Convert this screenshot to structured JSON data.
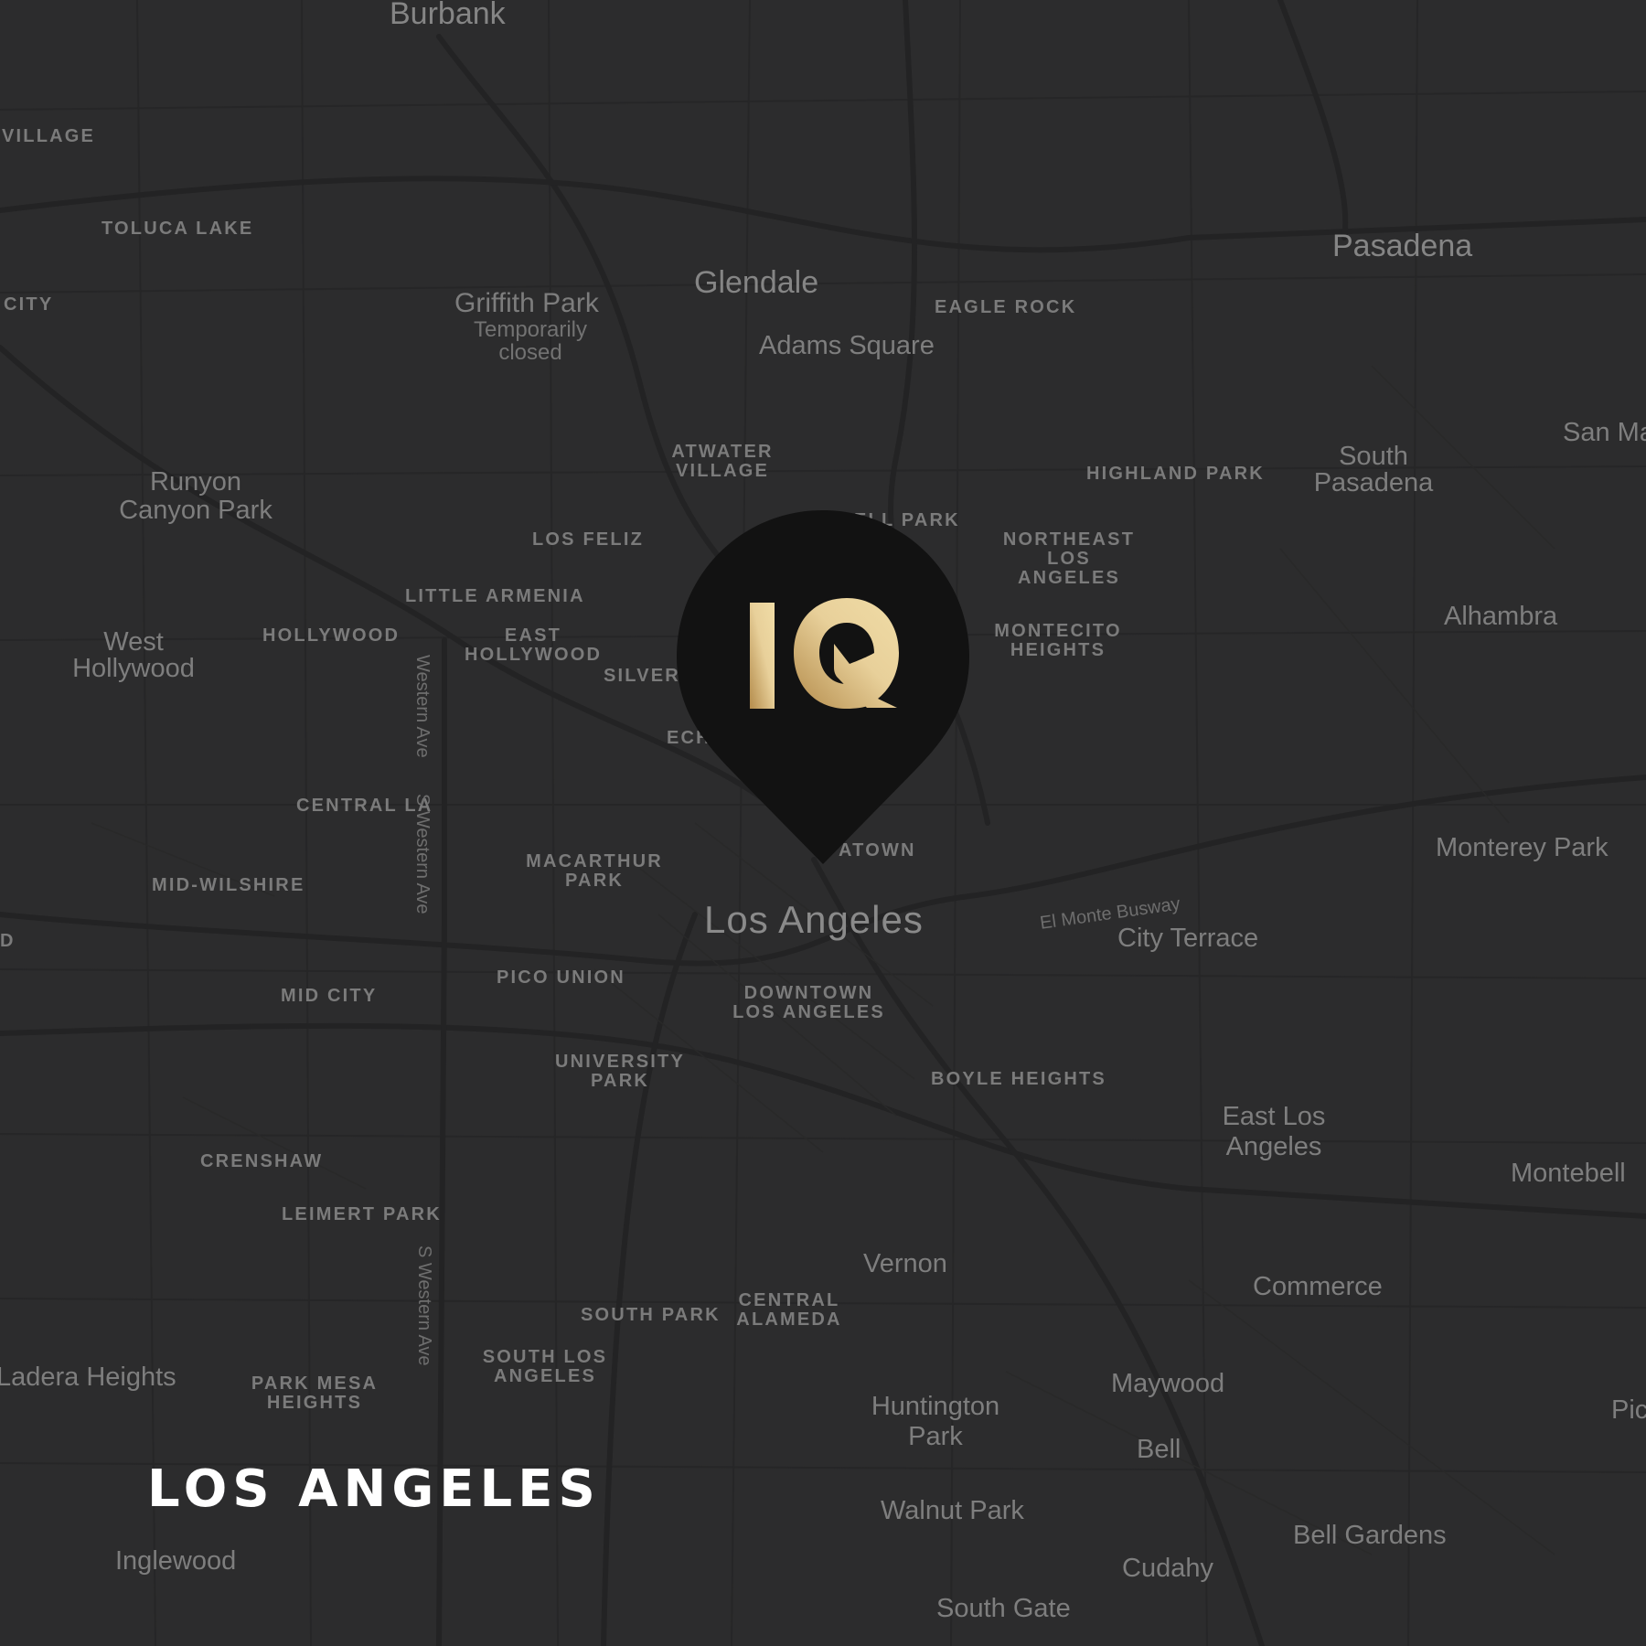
{
  "map": {
    "title": "LOS ANGELES",
    "marker": {
      "brand": "IQ",
      "icon": "map-pin-icon"
    },
    "colors": {
      "background": "#2c2c2d",
      "roads": "#222223",
      "pin": "#121212",
      "gold_light": "#f0dca6",
      "gold_dark": "#b48c4c"
    },
    "places": [
      {
        "name": "Burbank"
      },
      {
        "name": "Glendale"
      },
      {
        "name": "Pasadena"
      },
      {
        "name": "Adams Square"
      },
      {
        "name": "Runyon Canyon Park"
      },
      {
        "name": "West Hollywood"
      },
      {
        "name": "South Pasadena"
      },
      {
        "name": "San Ma"
      },
      {
        "name": "Alhambra"
      },
      {
        "name": "Monterey Park"
      },
      {
        "name": "Los Angeles"
      },
      {
        "name": "City Terrace"
      },
      {
        "name": "East Los Angeles"
      },
      {
        "name": "Montebell"
      },
      {
        "name": "Vernon"
      },
      {
        "name": "Commerce"
      },
      {
        "name": "Huntington Park"
      },
      {
        "name": "Maywood"
      },
      {
        "name": "Bell"
      },
      {
        "name": "Ladera Heights"
      },
      {
        "name": "Walnut Park"
      },
      {
        "name": "Bell Gardens"
      },
      {
        "name": "Inglewood"
      },
      {
        "name": "Cudahy"
      },
      {
        "name": "South Gate"
      },
      {
        "name": "Pic"
      }
    ],
    "park": {
      "name": "Griffith Park",
      "status": "Temporarily closed"
    },
    "neighborhoods": [
      {
        "name": "VILLAGE"
      },
      {
        "name": "TOLUCA LAKE"
      },
      {
        "name": "CITY"
      },
      {
        "name": "EAGLE ROCK"
      },
      {
        "name": "ATWATER VILLAGE"
      },
      {
        "name": "HIGHLAND PARK"
      },
      {
        "name": "LOS FELIZ"
      },
      {
        "name": "ELL PARK"
      },
      {
        "name": "NORTHEAST LOS ANGELES"
      },
      {
        "name": "LITTLE ARMENIA"
      },
      {
        "name": "HOLLYWOOD"
      },
      {
        "name": "EAST HOLLYWOOD"
      },
      {
        "name": "SILVER"
      },
      {
        "name": "MONTECITO HEIGHTS"
      },
      {
        "name": "ECH"
      },
      {
        "name": "CENTRAL LA"
      },
      {
        "name": "MACARTHUR PARK"
      },
      {
        "name": "ATOWN"
      },
      {
        "name": "MID-WILSHIRE"
      },
      {
        "name": "D"
      },
      {
        "name": "PICO UNION"
      },
      {
        "name": "DOWNTOWN LOS ANGELES"
      },
      {
        "name": "MID CITY"
      },
      {
        "name": "UNIVERSITY PARK"
      },
      {
        "name": "BOYLE HEIGHTS"
      },
      {
        "name": "CRENSHAW"
      },
      {
        "name": "LEIMERT PARK"
      },
      {
        "name": "SOUTH PARK"
      },
      {
        "name": "CENTRAL ALAMEDA"
      },
      {
        "name": "SOUTH LOS ANGELES"
      },
      {
        "name": "PARK MESA HEIGHTS"
      }
    ],
    "streets": [
      {
        "name": "Western Ave"
      },
      {
        "name": "S Western Ave"
      },
      {
        "name": "El Monte Busway"
      },
      {
        "name": "S Western Ave"
      }
    ]
  }
}
